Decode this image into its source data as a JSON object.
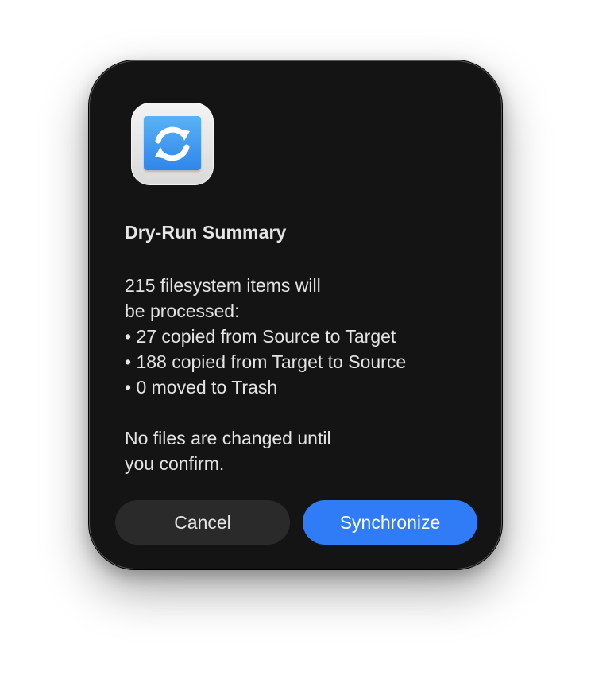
{
  "dialog": {
    "icon": "sync-arrows-icon",
    "title": "Dry-Run Summary",
    "message_lines": [
      "215 filesystem items will",
      "be processed:",
      "• 27 copied from Source to Target",
      "• 188 copied from Target to Source",
      "• 0 moved to Trash"
    ],
    "note_lines": [
      "No files are changed until",
      "you confirm."
    ],
    "cancel_label": "Cancel",
    "confirm_label": "Synchronize"
  },
  "colors": {
    "dialog_background": "#141414",
    "primary_button": "#2f7cf6",
    "secondary_button": "#2a2a2a",
    "icon_tile": "#3d95ee"
  }
}
